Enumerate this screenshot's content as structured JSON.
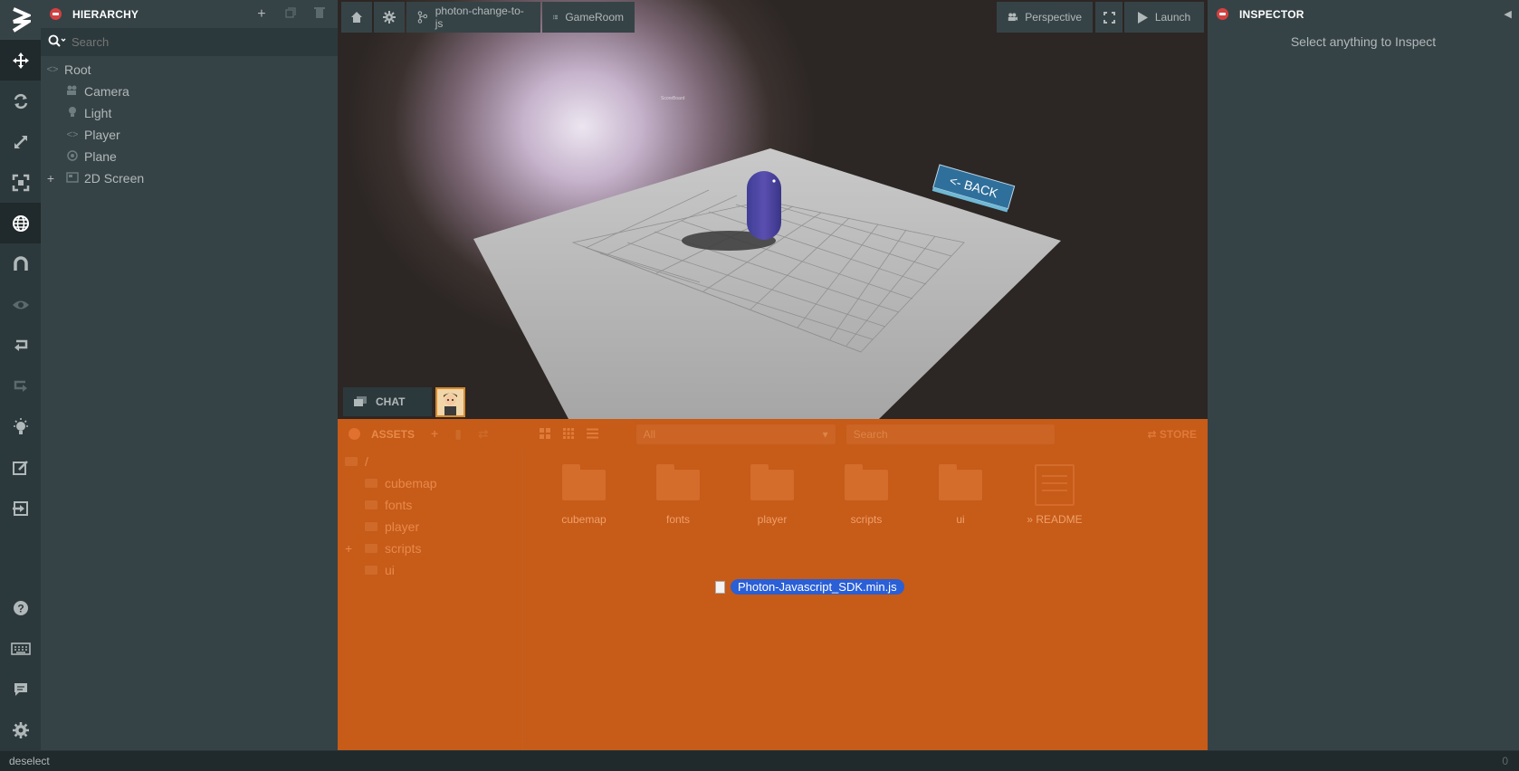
{
  "toolbar": {
    "items": [
      "translate-icon",
      "rotate-icon",
      "scale-icon",
      "resize-icon",
      "world-icon",
      "snap-icon",
      "view-icon",
      "undo-icon",
      "redo-icon",
      "lightmapper-icon",
      "code-editor-icon",
      "publish-icon"
    ],
    "bottom": [
      "help-icon",
      "keyboard-icon",
      "chat-icon",
      "settings-icon"
    ]
  },
  "hierarchy": {
    "title": "HIERARCHY",
    "search_placeholder": "Search",
    "root": "Root",
    "items": [
      "Camera",
      "Light",
      "Player",
      "Plane",
      "2D Screen"
    ]
  },
  "viewport": {
    "branch": "photon-change-to-js",
    "scene": "GameRoom",
    "camera": "Perspective",
    "launch": "Launch",
    "chat": "CHAT",
    "back_sign": "<- BACK"
  },
  "inspector": {
    "title": "INSPECTOR",
    "empty": "Select anything to Inspect"
  },
  "assets": {
    "title": "ASSETS",
    "type_filter": "All",
    "search_placeholder": "Search",
    "store": "STORE",
    "root": "/",
    "tree": [
      "cubemap",
      "fonts",
      "player",
      "scripts",
      "ui"
    ],
    "tiles": [
      "cubemap",
      "fonts",
      "player",
      "scripts",
      "ui"
    ],
    "readme": "README",
    "dragging_file": "Photon-Javascript_SDK.min.js"
  },
  "statusbar": {
    "message": "deselect",
    "count": "0"
  },
  "colors": {
    "panel": "#364346",
    "toolbar": "#2c393c",
    "accent": "#d34141",
    "assets_drop": "#c75b18",
    "selection": "#2a5fd6"
  }
}
